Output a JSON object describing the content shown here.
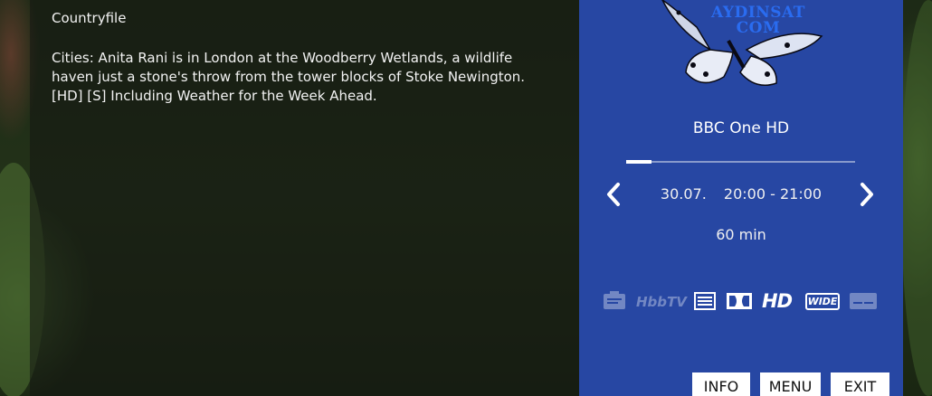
{
  "programme": {
    "title": "Countryfile",
    "description": "Cities: Anita Rani is in London at the Woodberry Wetlands, a wildlife haven just a stone's throw from the tower blocks of Stoke Newington. [HD] [S] Including Weather for the Week Ahead."
  },
  "logo": {
    "line1": "AYDINSAT",
    "line2": "COM"
  },
  "channel": {
    "name": "BBC One HD",
    "date": "30.07.",
    "time_range": "20:00 - 21:00",
    "duration": "60 min",
    "progress_fraction": 0.11
  },
  "feature_icons": [
    "info-sheet-icon",
    "hbbtv-icon",
    "teletext-icon",
    "dolby-icon",
    "hd-icon",
    "widescreen-icon",
    "subtitles-icon"
  ],
  "icon_labels": {
    "hbbtv": "HbbTV",
    "hd": "HD",
    "wide": "WIDE"
  },
  "buttons": {
    "info": "INFO",
    "menu": "MENU",
    "exit": "EXIT"
  },
  "colors": {
    "panel": "#2747a3",
    "logo_text": "#2a6cf0"
  }
}
